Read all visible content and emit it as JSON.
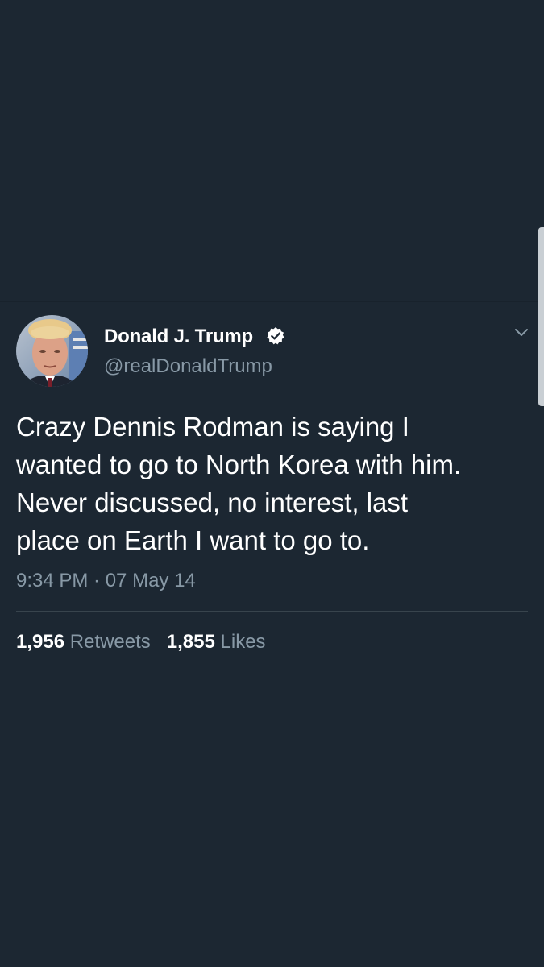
{
  "tweet": {
    "author_name": "Donald J. Trump",
    "author_handle": "@realDonaldTrump",
    "verified_icon": "verified-badge-icon",
    "text": "Crazy Dennis Rodman is saying I\nwanted to go to North Korea with him.\nNever discussed, no interest, last\nplace on Earth I want to go to.",
    "timestamp": "9:34 PM · 07 May 14"
  },
  "stats": {
    "retweets_count": "1,956",
    "retweets_label": "Retweets",
    "likes_count": "1,855",
    "likes_label": "Likes"
  },
  "colors": {
    "background": "#1c2732",
    "secondary_text": "#8899a6",
    "divider": "#38444d"
  }
}
